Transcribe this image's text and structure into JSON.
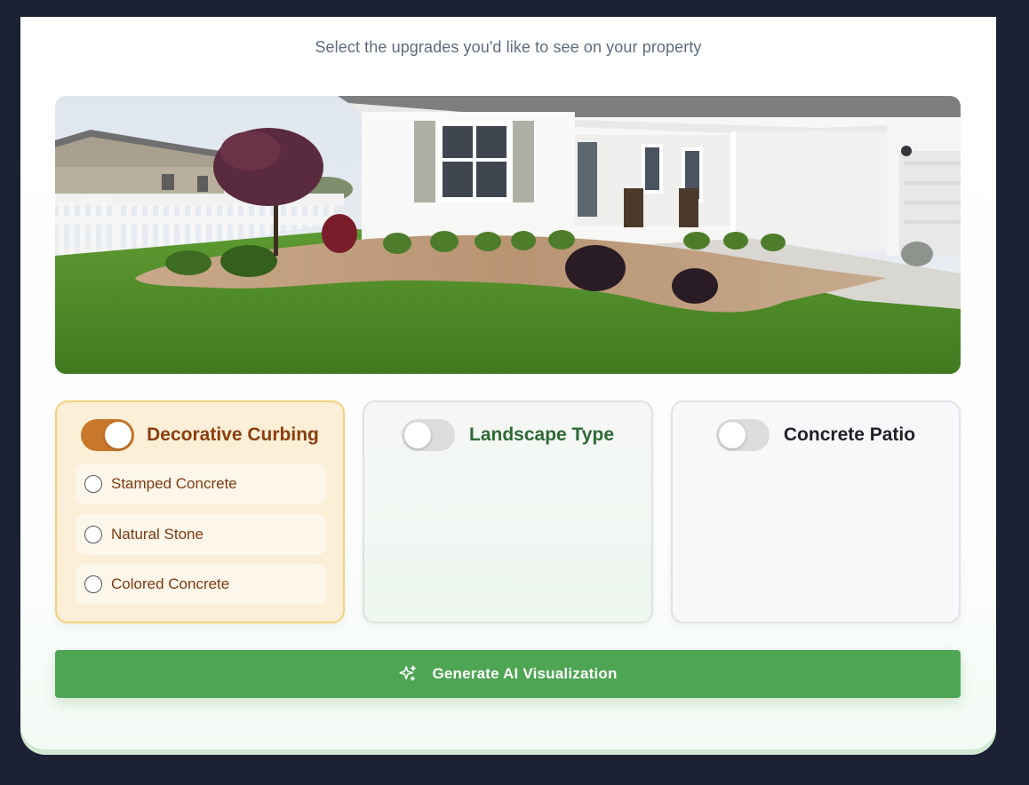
{
  "header": {
    "subtitle": "Select the upgrades you'd like to see on your property"
  },
  "photo": {
    "alt": "Front yard with house, lawn, mulch bed and curbing"
  },
  "upgrades": [
    {
      "title": "Decorative Curbing",
      "enabled": true,
      "options": [
        {
          "label": "Stamped Concrete",
          "selected": false
        },
        {
          "label": "Natural Stone",
          "selected": false
        },
        {
          "label": "Colored Concrete",
          "selected": false
        }
      ]
    },
    {
      "title": "Landscape Type",
      "enabled": false,
      "options": []
    },
    {
      "title": "Concrete Patio",
      "enabled": false,
      "options": []
    }
  ],
  "actions": {
    "generate_label": "Generate AI Visualization",
    "generate_icon": "sparkles-icon"
  },
  "colors": {
    "accent_green": "#4ea553",
    "toggle_on": "#c8782a",
    "curbing_card_bg": "#fcefd7",
    "curbing_card_border": "#f2d27a",
    "background": "#1c2233"
  }
}
